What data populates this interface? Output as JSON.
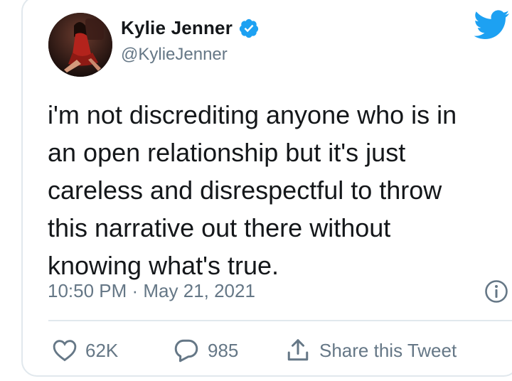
{
  "tweet": {
    "author": {
      "display_name": "Kylie Jenner",
      "handle": "@KylieJenner",
      "verified": true
    },
    "text": "i'm not discrediting anyone who is in\nan open relationship but it's just\ncareless and disrespectful to throw\nthis narrative out there without\nknowing what's true.",
    "timestamp": "10:50 PM · May 21, 2021",
    "actions": {
      "likes": "62K",
      "replies": "985",
      "share_label": "Share this Tweet"
    }
  },
  "colors": {
    "text_primary": "#14171a",
    "text_secondary": "#657786",
    "brand_blue": "#1da1f2",
    "border": "#e1e8ed"
  },
  "icons": {
    "brand": "twitter-bird-icon",
    "verified": "verified-badge-icon",
    "info": "info-icon",
    "like": "heart-icon",
    "reply": "reply-bubble-icon",
    "share": "share-icon"
  }
}
